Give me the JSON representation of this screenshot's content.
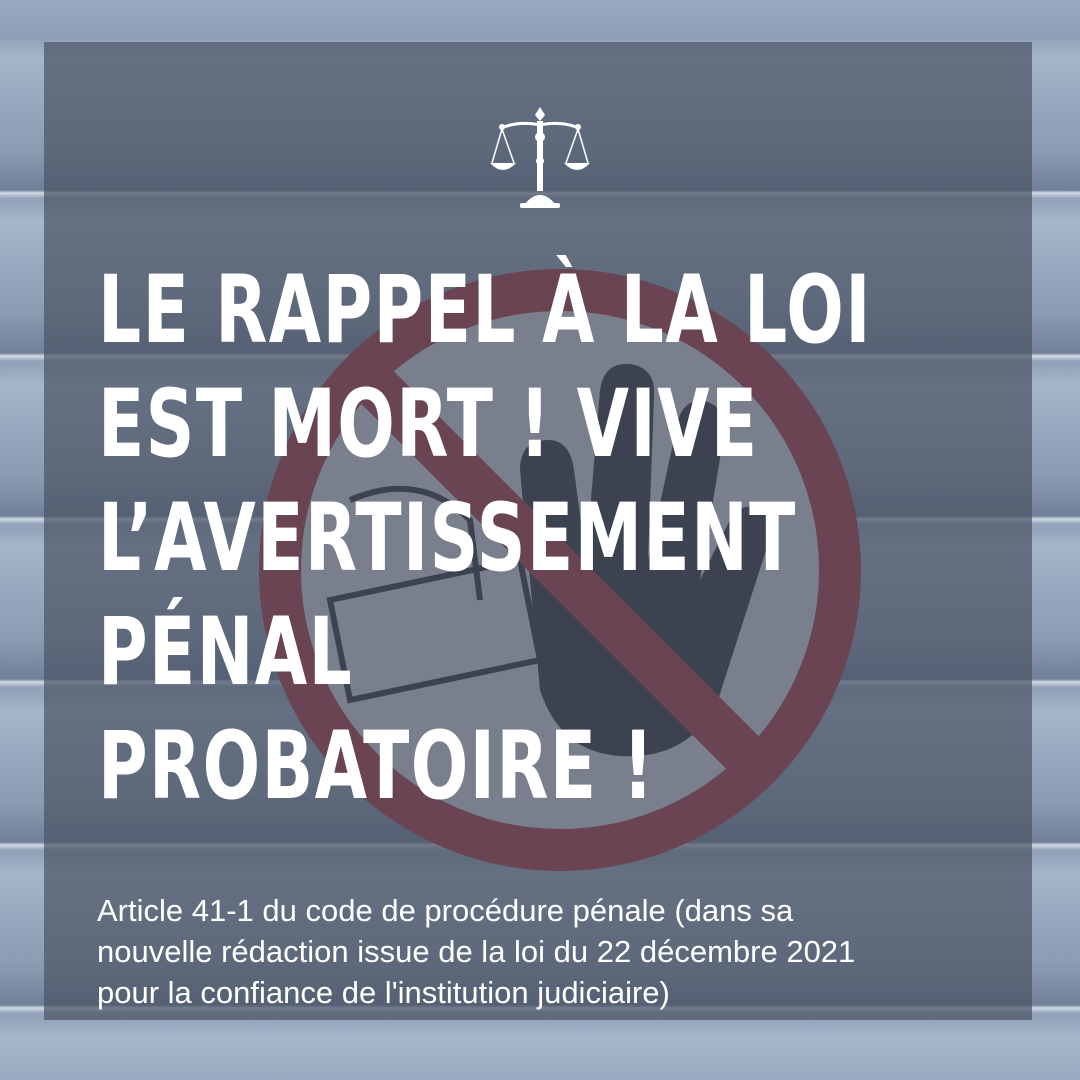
{
  "emblem": {
    "icon": "scales-of-justice-icon"
  },
  "background": {
    "icon": "prohibition-hand-sign-icon",
    "colors": {
      "sign_red": "#b5232a",
      "sign_white": "#e8e8ea",
      "hand_dark": "#1c1c22",
      "overlay": "#4a5264"
    }
  },
  "headline": {
    "lines": [
      "LE RAPPEL À LA LOI",
      "EST MORT ! VIVE",
      "L’AVERTISSEMENT",
      "PÉNAL",
      "PROBATOIRE !"
    ]
  },
  "caption": {
    "lines": [
      "Article 41-1 du code de procédure pénale (dans sa",
      "nouvelle rédaction issue de la loi du 22 décembre 2021",
      "pour la confiance de l'institution judiciaire)"
    ]
  }
}
